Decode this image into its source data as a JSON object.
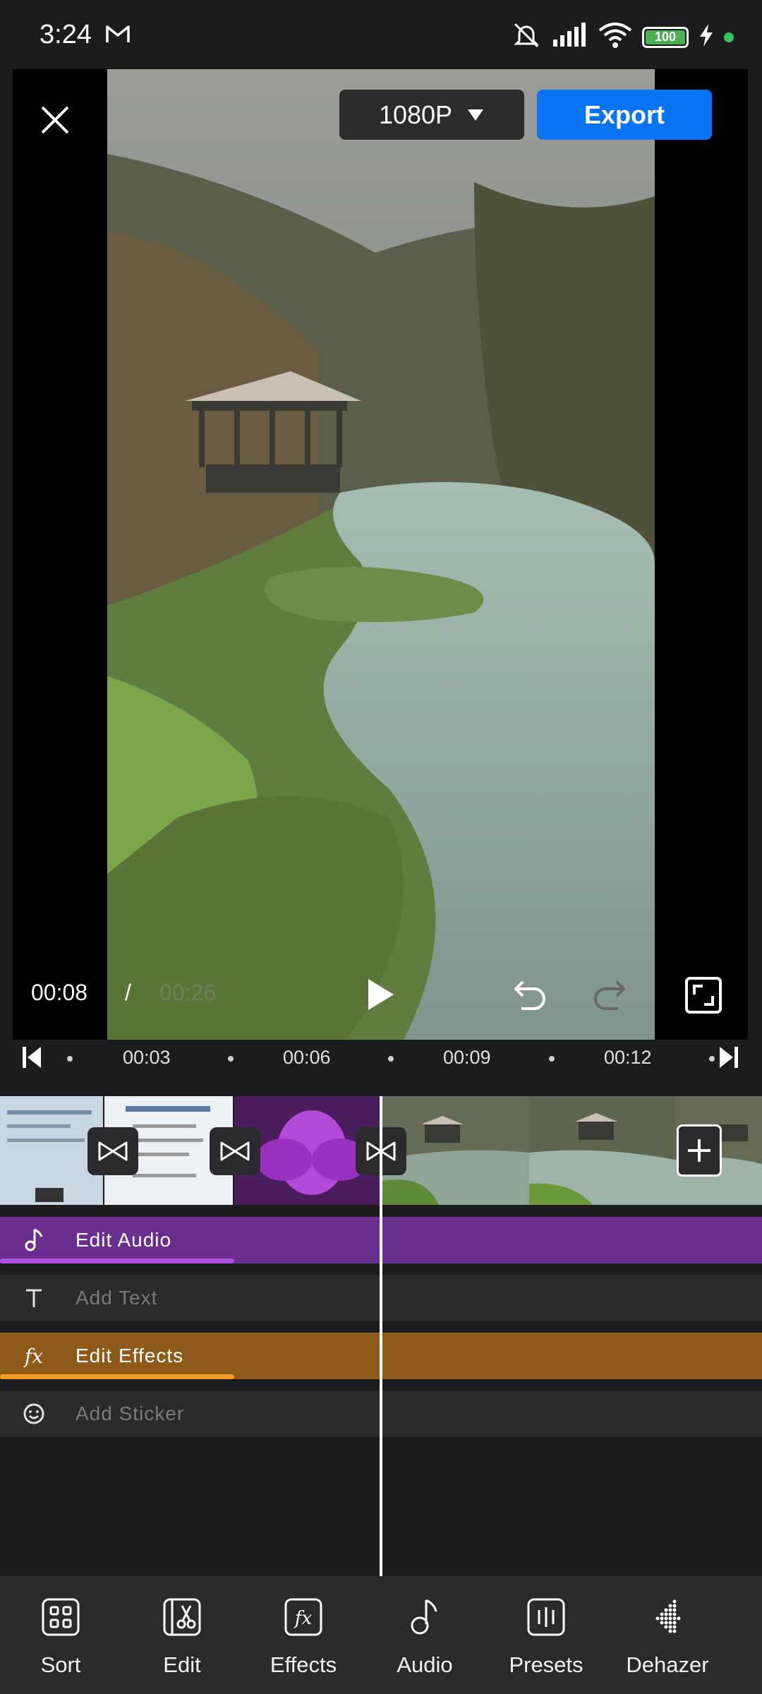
{
  "status": {
    "time": "3:24",
    "battery": "100"
  },
  "header": {
    "resolution": "1080P",
    "export_label": "Export"
  },
  "playback": {
    "current": "00:08",
    "separator": "/",
    "total": "00:26"
  },
  "ruler": {
    "labels": [
      "00:03",
      "00:06",
      "00:09",
      "00:12"
    ]
  },
  "tracks": [
    {
      "label": "Edit Audio",
      "icon": "music-note-icon",
      "active": true,
      "color": "#6a2f8e",
      "progress_color": "#b04fe0"
    },
    {
      "label": "Add Text",
      "icon": "text-icon",
      "active": false
    },
    {
      "label": "Edit Effects",
      "icon": "fx-icon",
      "active": true,
      "color": "#8e5a1a",
      "progress_color": "#f59b22"
    },
    {
      "label": "Add Sticker",
      "icon": "smiley-icon",
      "active": false
    }
  ],
  "nav": {
    "items": [
      {
        "label": "Sort",
        "icon": "grid-icon"
      },
      {
        "label": "Edit",
        "icon": "scissors-film-icon"
      },
      {
        "label": "Effects",
        "icon": "fx-icon"
      },
      {
        "label": "Audio",
        "icon": "music-note-icon"
      },
      {
        "label": "Presets",
        "icon": "sliders-icon"
      },
      {
        "label": "Dehazer",
        "icon": "dehaze-icon"
      }
    ]
  },
  "colors": {
    "accent": "#0a74f5",
    "background": "#1c1c1e",
    "nav_background": "#2a2a2c"
  }
}
